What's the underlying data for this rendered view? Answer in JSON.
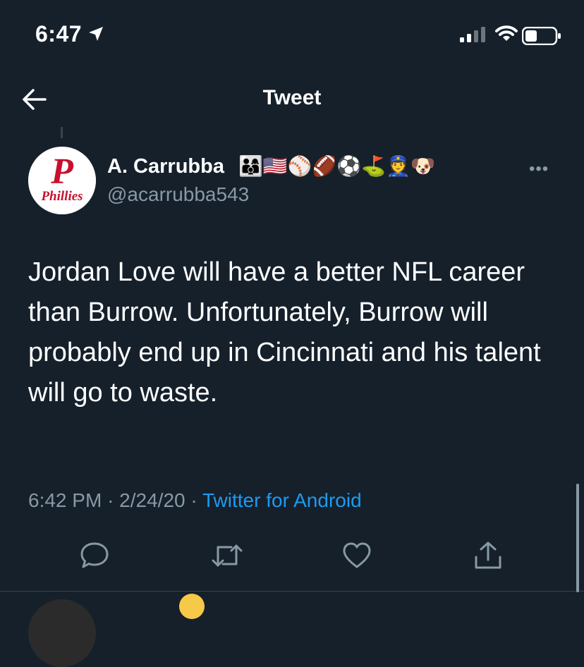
{
  "status_bar": {
    "time": "6:47",
    "icons": [
      "location-arrow-icon",
      "cellular-signal-icon",
      "wifi-icon",
      "battery-icon"
    ]
  },
  "header": {
    "title": "Tweet",
    "back_icon": "back-arrow-icon"
  },
  "tweet": {
    "author": {
      "name": "A. Carrubba",
      "name_emojis": "👨‍👩‍👦🇺🇸⚾🏈⚽⛳👮🐶",
      "handle": "@acarrubba543",
      "avatar_text": "Phillies",
      "avatar_letter": "P"
    },
    "text": "Jordan Love will have a better NFL career than Burrow. Unfortunately, Burrow will probably end up in Cincinnati and his talent will go to waste.",
    "time": "6:42 PM",
    "date": "2/24/20",
    "separator": "·",
    "source": "Twitter for Android",
    "more": "•••"
  },
  "actions": [
    "reply-icon",
    "retweet-icon",
    "like-icon",
    "share-icon"
  ],
  "colors": {
    "background": "#15202b",
    "secondary_text": "#8899a6",
    "link": "#1d9bf0",
    "avatar_red": "#c8102e"
  }
}
